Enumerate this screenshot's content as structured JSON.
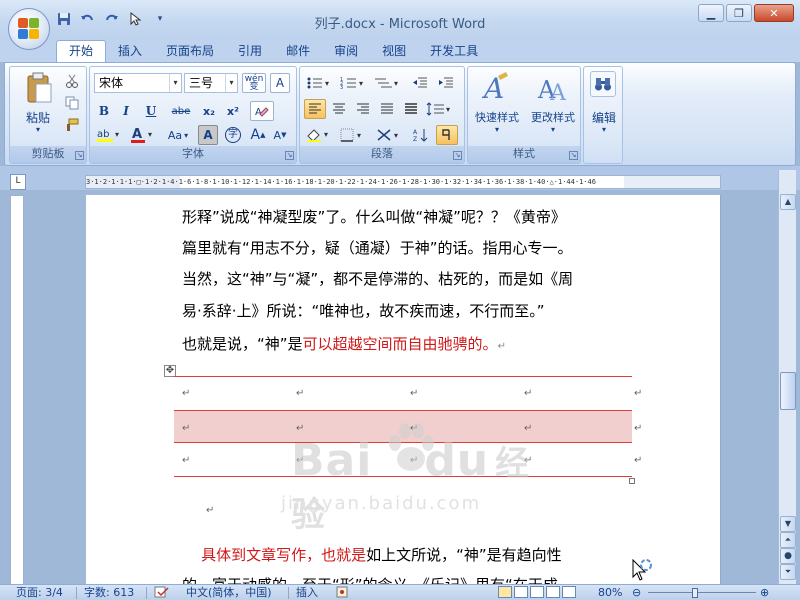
{
  "window": {
    "title": "列子.docx - Microsoft Word",
    "controls": [
      "minimize",
      "restore",
      "close"
    ]
  },
  "qat": {
    "icons": [
      "save-icon",
      "undo-icon",
      "redo-icon",
      "cursor-icon",
      "dropdown-icon"
    ]
  },
  "tabs": [
    "开始",
    "插入",
    "页面布局",
    "引用",
    "邮件",
    "审阅",
    "视图",
    "开发工具"
  ],
  "active_tab": "开始",
  "ribbon": {
    "clipboard": {
      "label": "剪贴板",
      "paste": "粘贴"
    },
    "font": {
      "label": "字体",
      "font_name": "宋体",
      "font_size": "三号",
      "wen_label": "wén\n变",
      "bold": "B",
      "italic": "I",
      "underline": "U",
      "strike": "abe",
      "sub": "x₂",
      "sup": "x²",
      "font_color": "A",
      "aa": "Aa",
      "char_shade": "A",
      "circle_char": "字",
      "grow": "A",
      "shrink": "A",
      "border_char": "A"
    },
    "paragraph": {
      "label": "段落"
    },
    "styles": {
      "label": "样式",
      "quick_styles": "快速样式",
      "change_styles": "更改样式"
    },
    "editing": {
      "label": "编辑",
      "edit": "编辑"
    }
  },
  "ruler": {
    "marks": "3·1·2·1·1·1·□·1·2·1·4·1·6·1·8·1·10·1·12·1·14·1·16·1·18·1·20·1·22·1·24·1·26·1·28·1·30·1·32·1·34·1·36·1·38·1·40·△·1·44·1·46"
  },
  "document": {
    "lines": [
      {
        "parts": [
          {
            "t": "形释”说成“神凝型废”了。什么叫做“神凝”呢？？《黄帝》",
            "red": false
          }
        ]
      },
      {
        "parts": [
          {
            "t": "篇里就有“用志不分，疑（通凝）于神”的话。指用心专一。",
            "red": false
          }
        ]
      },
      {
        "parts": [
          {
            "t": "当然，这“神”与“凝”，都不是停滞的、枯死的，而是如《周",
            "red": false
          }
        ]
      },
      {
        "parts": [
          {
            "t": "易·系辞·上》所说：“唯神也，故不疾而速，不行而至。”",
            "red": false
          }
        ]
      },
      {
        "parts": [
          {
            "t": "也就是说，“神”是",
            "red": false
          },
          {
            "t": "可以超越空间而自由驰骋的。",
            "red": true
          },
          {
            "t": "↵",
            "red": false,
            "mark": true
          }
        ]
      },
      {
        "parts": [
          {
            "t": "↵",
            "red": false,
            "mark": true
          }
        ]
      },
      {
        "parts": [
          {
            "t": "    ",
            "red": false
          },
          {
            "t": "具体到文章写作，也就是",
            "red": true
          },
          {
            "t": "如上文所说，“神”是有趋向性",
            "red": false
          }
        ]
      },
      {
        "parts": [
          {
            "t": "的，富于动感的。至于“形”的含义，《乐记》里有“在天成",
            "red": false
          }
        ]
      }
    ],
    "paragraph_mark": "↵",
    "table_handle": "✥"
  },
  "watermark": {
    "logo": "Bai",
    "logo2": "du",
    "cn": "经验",
    "url": "jingyan.baidu.com"
  },
  "status": {
    "page": "页面: 3/4",
    "words": "字数: 613",
    "language": "中文(简体，中国)",
    "mode": "插入",
    "zoom": "80%"
  }
}
